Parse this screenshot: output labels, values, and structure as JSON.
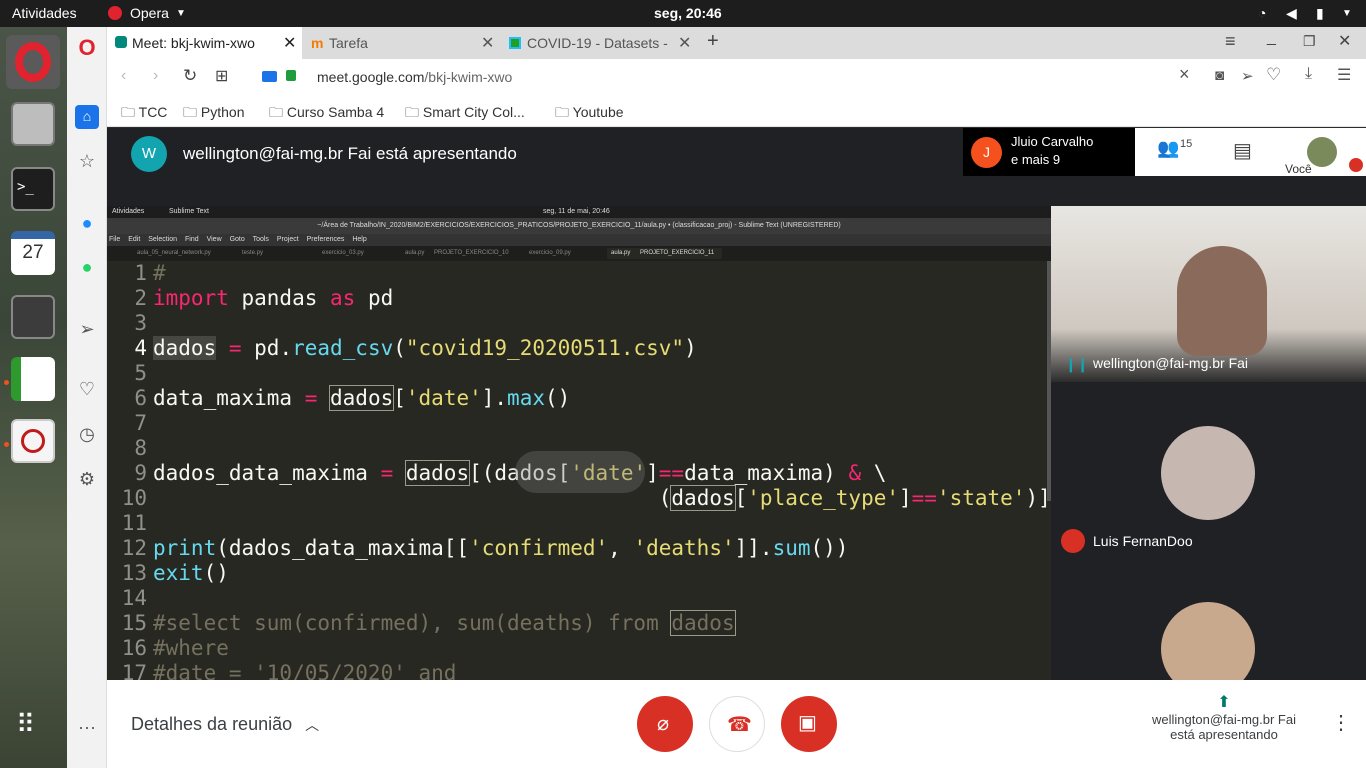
{
  "system_bar": {
    "activities": "Atividades",
    "app": "Opera",
    "clock": "seg, 20:46"
  },
  "dock": {
    "calendar_day": "27"
  },
  "tabs": [
    {
      "label": "Meet: bkj-kwim-xwo"
    },
    {
      "label": "Tarefa"
    },
    {
      "label": "COVID-19 - Datasets -"
    }
  ],
  "address": {
    "domain": "meet.google.com",
    "path": "/bkj-kwim-xwo"
  },
  "bookmarks": [
    "TCC",
    "Python",
    "Curso Samba 4",
    "Smart City Col...",
    "Youtube"
  ],
  "meet": {
    "presenter_initial": "W",
    "presenter_text": "wellington@fai-mg.br Fai está apresentando",
    "participants_summary": {
      "initial": "J",
      "name": "Jluio Carvalho",
      "more": "e mais 9"
    },
    "participant_count": "15",
    "self_label": "Você",
    "tiles": [
      {
        "name": "wellington@fai-mg.br Fai"
      },
      {
        "name": "Luis FernanDoo"
      }
    ],
    "meeting_details": "Detalhes da reunião",
    "presenting_status": {
      "line1": "wellington@fai-mg.br Fai",
      "line2": "está apresentando"
    }
  },
  "shared_screen": {
    "top_activities": "Atividades",
    "top_app": "Sublime Text",
    "top_clock": "seg, 11 de mai, 20:46",
    "window_title": "~/Área de Trabalho/IN_2020/BIM2/EXERCICIOS/EXERCICIOS_PRATICOS/PROJETO_EXERCICIO_11/aula.py • (classificacao_proj) - Sublime Text (UNREGISTERED)",
    "menu": [
      "File",
      "Edit",
      "Selection",
      "Find",
      "View",
      "Goto",
      "Tools",
      "Project",
      "Preferences",
      "Help"
    ],
    "file_tabs": [
      "aula_05_neural_network.py",
      "teste.py",
      "exercicio_03.py",
      "aula.py",
      "PROJETO_EXERCICIO_10",
      "exercicio_09.py",
      "aula.py",
      "PROJETO_EXERCICIO_11"
    ],
    "line_numbers": [
      "1",
      "2",
      "3",
      "4",
      "5",
      "6",
      "7",
      "8",
      "9",
      "10",
      "11",
      "12",
      "13",
      "14",
      "15",
      "16",
      "17"
    ],
    "code": {
      "l1": "#",
      "l2_kw": "import",
      "l2_a": " pandas ",
      "l2_as": "as",
      "l2_b": " pd",
      "l4_a": "dados",
      "l4_eq": " = ",
      "l4_b": "pd.",
      "l4_fn": "read_csv",
      "l4_c": "(",
      "l4_str": "\"covid19_20200511.csv\"",
      "l4_d": ")",
      "l6_a": "data_maxima",
      "l6_eq": " = ",
      "l6_b": "dados",
      "l6_c": "[",
      "l6_str": "'date'",
      "l6_d": "].",
      "l6_fn": "max",
      "l6_e": "()",
      "l9_a": "dados_data_maxima",
      "l9_eq": " = ",
      "l9_b": "dados",
      "l9_c": "[(dados[",
      "l9_str": "'date'",
      "l9_d": "]",
      "l9_op": "==",
      "l9_e": "data_maxima) ",
      "l9_amp": "&",
      "l9_f": " \\",
      "l10_pad": "                    ",
      "l10_a": "(",
      "l10_b": "dados",
      "l10_c": "[",
      "l10_str": "'place_type'",
      "l10_d": "]",
      "l10_op": "==",
      "l10_str2": "'state'",
      "l10_e": ")]",
      "l12_fn": "print",
      "l12_a": "(dados_data_maxima[[",
      "l12_s1": "'confirmed'",
      "l12_b": ", ",
      "l12_s2": "'deaths'",
      "l12_c": "]].",
      "l12_fn2": "sum",
      "l12_d": "())",
      "l13_fn": "exit",
      "l13_a": "()",
      "l15_cm": "#select sum(confirmed), sum(deaths) from ",
      "l15_box": "dados",
      "l16_cm": "#where",
      "l17_cm": "#date = '10/05/2020' and"
    }
  }
}
